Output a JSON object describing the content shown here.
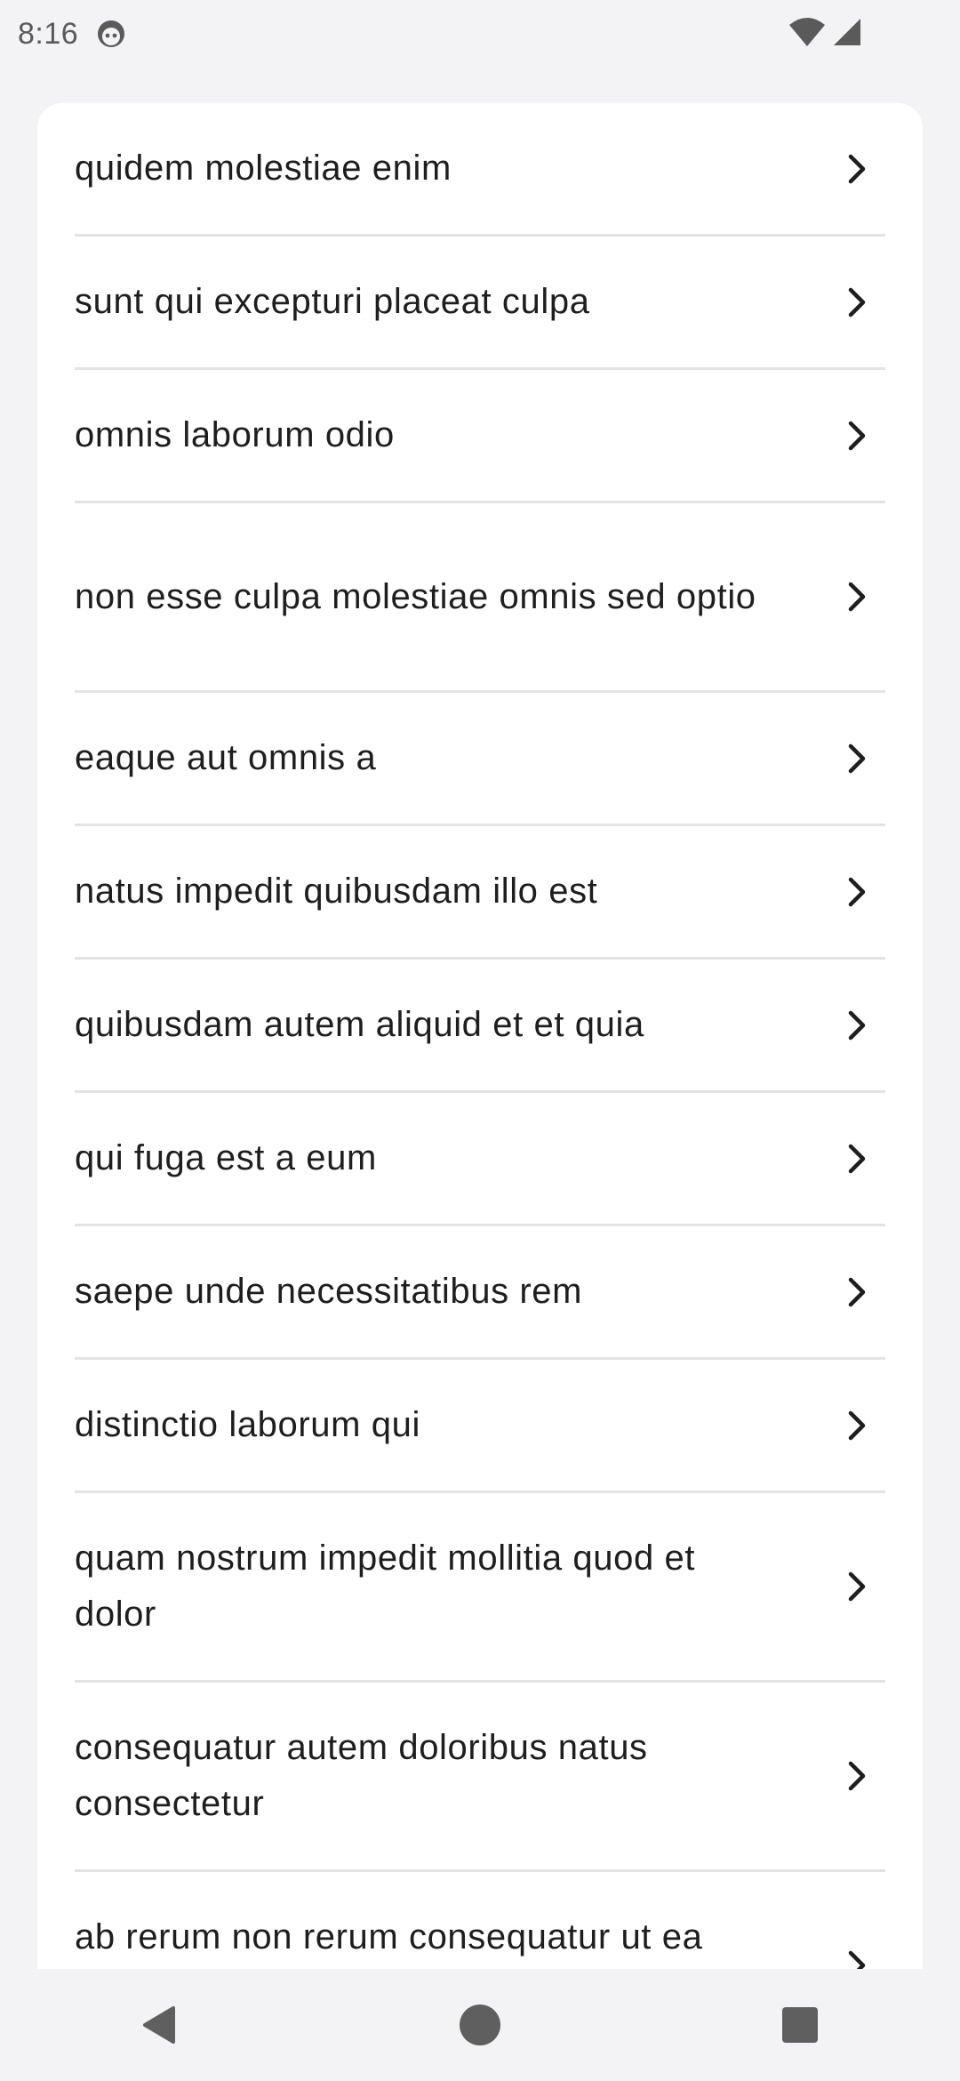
{
  "status_bar": {
    "time": "8:16",
    "face_icon": "android-face-icon",
    "wifi_icon": "wifi-icon",
    "signal_icon": "cell-signal-icon"
  },
  "list": {
    "items": [
      {
        "label": "quidem molestiae enim"
      },
      {
        "label": "sunt qui excepturi placeat culpa"
      },
      {
        "label": "omnis laborum odio"
      },
      {
        "label": "non esse culpa molestiae omnis sed optio"
      },
      {
        "label": "eaque aut omnis a"
      },
      {
        "label": "natus impedit quibusdam illo est"
      },
      {
        "label": "quibusdam autem aliquid et et quia"
      },
      {
        "label": "qui fuga est a eum"
      },
      {
        "label": "saepe unde necessitatibus rem"
      },
      {
        "label": "distinctio laborum qui"
      },
      {
        "label": "quam nostrum impedit mollitia quod et dolor"
      },
      {
        "label": "consequatur autem doloribus natus consectetur"
      },
      {
        "label": "ab rerum non rerum consequatur ut ea unde"
      }
    ],
    "chevron_icon": "chevron-right-icon"
  },
  "nav_bar": {
    "back_icon": "back-triangle-icon",
    "home_icon": "home-circle-icon",
    "recents_icon": "recents-square-icon"
  },
  "colors": {
    "background": "#f3f3f5",
    "card": "#ffffff",
    "divider": "#e3e3e3",
    "text": "#1e1e1e",
    "nav_icon": "#5f5f5f"
  }
}
